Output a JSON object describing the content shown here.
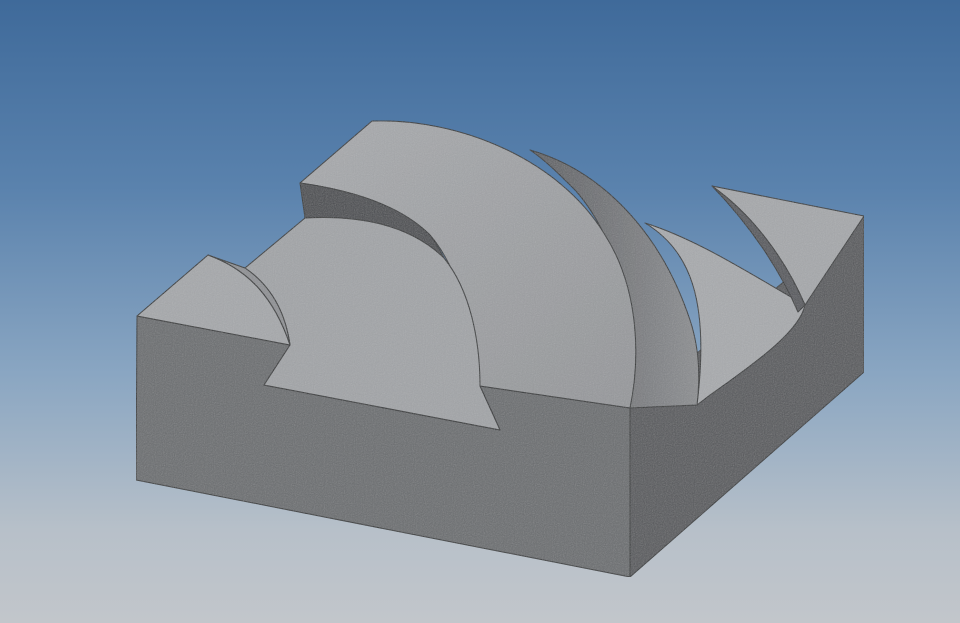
{
  "viewport": {
    "background_top": "#3f6a9a",
    "background_bottom": "#c2c6cb"
  },
  "model": {
    "material": "stone-gray",
    "front_face_color": "#6b6d70",
    "right_face_color": "#56585c",
    "top_face_color": "#9a9c9f",
    "shell_color": "#a2a4a7",
    "shadow_face_color": "#4a4c50",
    "edge_color": "#2e3033"
  }
}
